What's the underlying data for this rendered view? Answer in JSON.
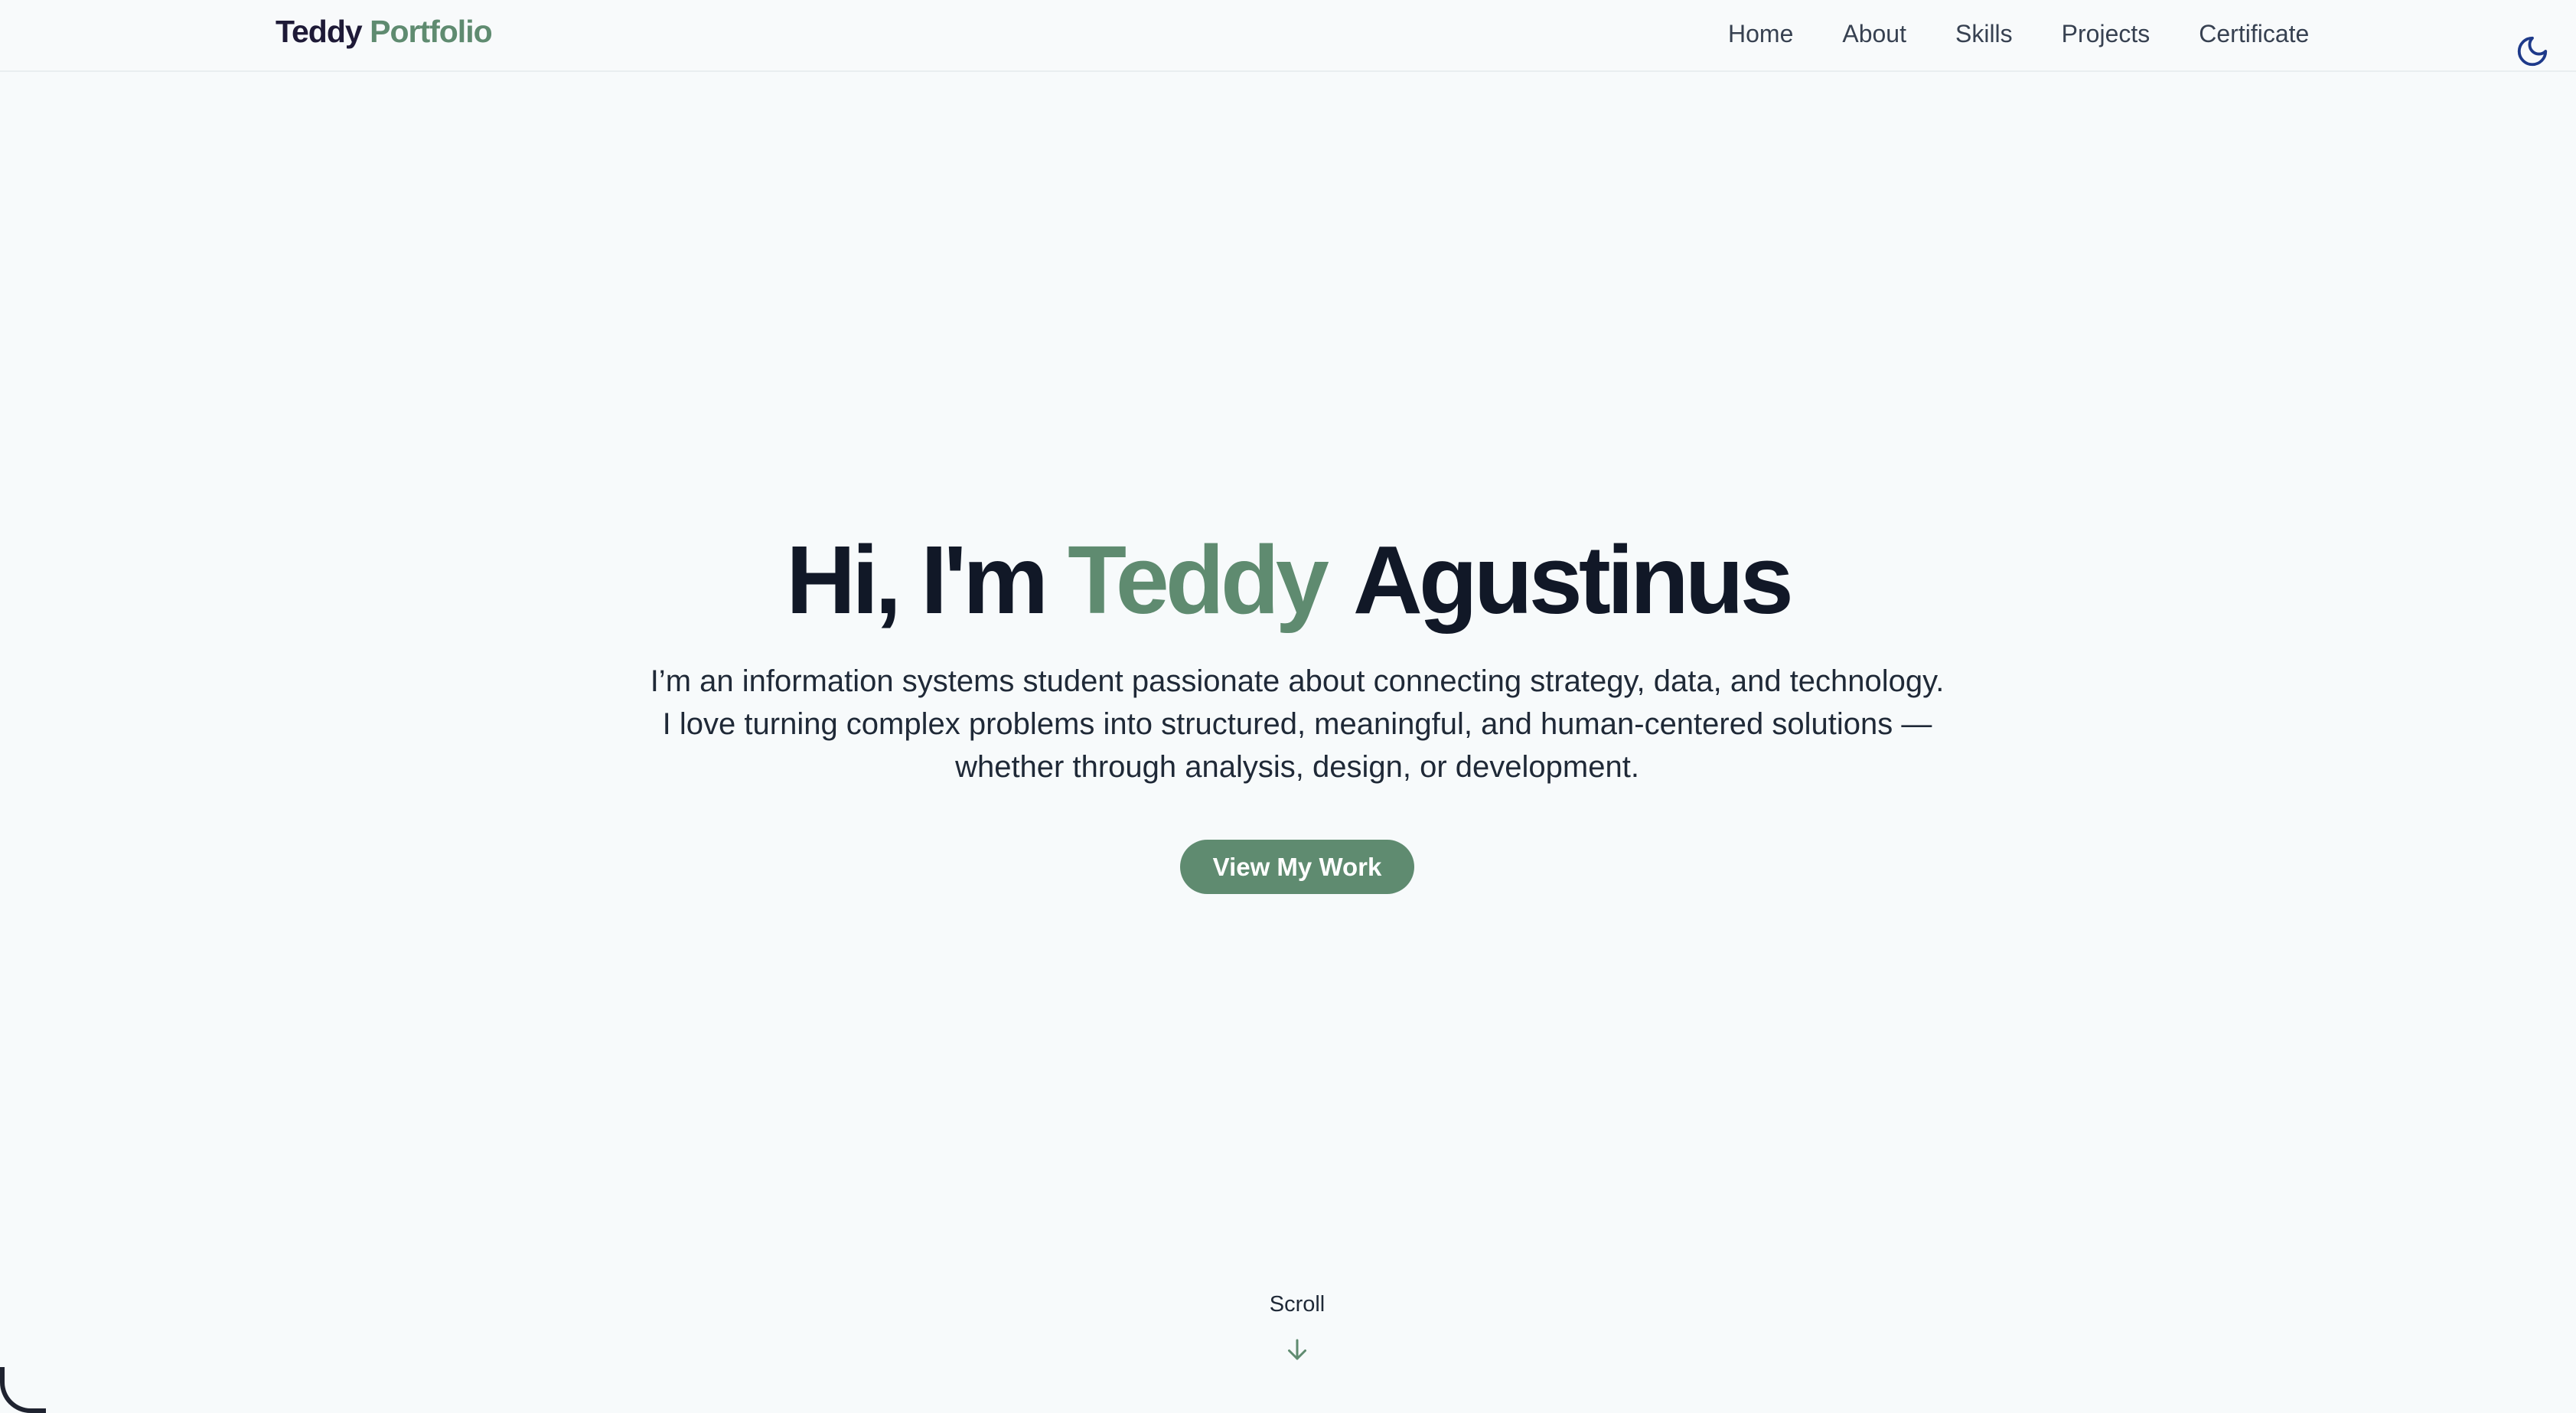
{
  "navbar": {
    "logo_first": "Teddy",
    "logo_second": "Portfolio",
    "links": [
      "Home",
      "About",
      "Skills",
      "Projects",
      "Certificate"
    ],
    "theme_toggle_icon": "moon-icon"
  },
  "hero": {
    "greeting": "Hi, I'm",
    "first_name": "Teddy",
    "last_name": "Agustinus",
    "description": "I’m an information systems student passionate about connecting strategy, data, and technology. I love turning complex problems into structured, meaningful, and human-centered solutions — whether through analysis, design, or development.",
    "cta_label": "View My Work"
  },
  "scroll": {
    "label": "Scroll",
    "icon": "arrow-down-icon"
  },
  "colors": {
    "accent": "#5f8b70",
    "text_dark": "#111827",
    "background": "#f7fafb",
    "toggle_icon": "#1e3a8a"
  }
}
